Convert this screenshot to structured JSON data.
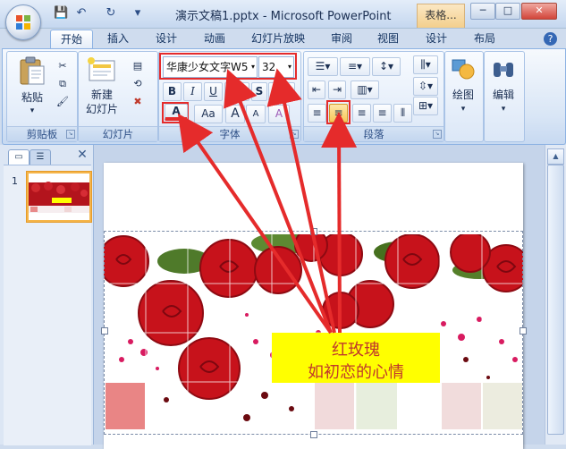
{
  "window": {
    "title": "演示文稿1.pptx - Microsoft PowerPoint",
    "context_tab": "表格...",
    "min": "─",
    "max": "□",
    "close": "✕"
  },
  "quick_access": {
    "save": "💾",
    "undo": "↶",
    "redo": "↻",
    "more": "▾"
  },
  "tabs": [
    {
      "label": "开始",
      "active": true
    },
    {
      "label": "插入"
    },
    {
      "label": "设计"
    },
    {
      "label": "动画"
    },
    {
      "label": "幻灯片放映"
    },
    {
      "label": "审阅"
    },
    {
      "label": "视图"
    },
    {
      "label": "设计"
    },
    {
      "label": "布局"
    }
  ],
  "help": "?",
  "clipboard": {
    "paste": "粘贴",
    "group": "剪贴板",
    "paste_arrow": "▾"
  },
  "slides_group": {
    "new_slide_line1": "新建",
    "new_slide_line2": "幻灯片",
    "group": "幻灯片"
  },
  "font": {
    "name": "华康少女文字W5",
    "size": "32",
    "bold": "B",
    "italic": "I",
    "underline": "U",
    "strike": "abc",
    "shadow": "S",
    "spacing": "AV",
    "font_color": "A",
    "case": "Aa",
    "grow": "A",
    "shrink": "A",
    "clear": "A",
    "group": "字体"
  },
  "paragraph": {
    "group": "段落"
  },
  "drawing": {
    "label": "绘图"
  },
  "editing": {
    "label": "编辑"
  },
  "slide_panel": {
    "thumb_number": "1",
    "close": "✕"
  },
  "caption": {
    "line1": "红玫瑰",
    "line2": "如初恋的心情"
  },
  "colors": {
    "accent_red": "#e52b2b",
    "caption_bg": "#ffff00",
    "caption_text": "#c0392b",
    "selection": "#f5b54a"
  }
}
